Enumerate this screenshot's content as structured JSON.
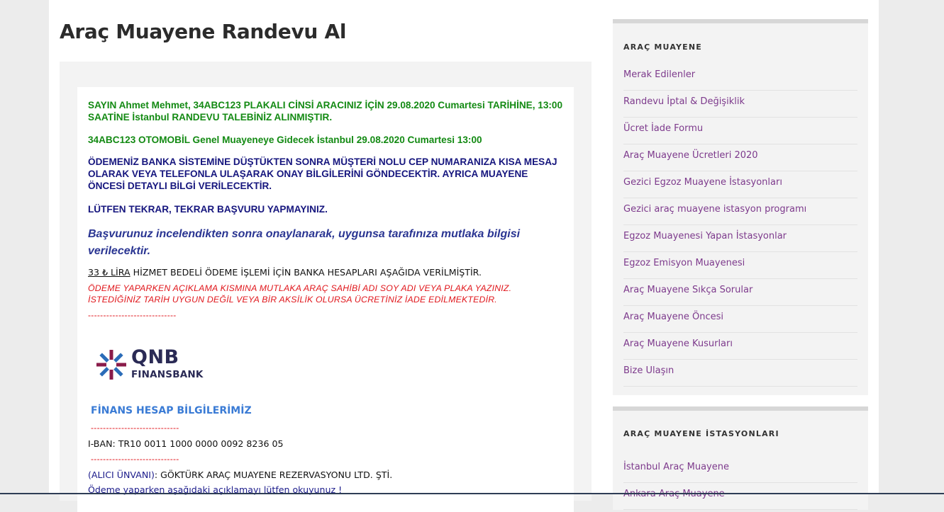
{
  "page_title": "Araç Muayene Randevu Al",
  "notice": {
    "line1": "SAYIN Ahmet Mehmet, 34ABC123 PLAKALI CİNSİ ARACINIZ İÇİN 29.08.2020 Cumartesi TARİHİNE, 13:00 SAATİNE İstanbul RANDEVU TALEBİNİZ ALINMIŞTIR.",
    "line2": "34ABC123 OTOMOBİL Genel Muayeneye Gidecek İstanbul 29.08.2020 Cumartesi 13:00",
    "line3": "ÖDEMENİZ BANKA SİSTEMİNE DÜŞTÜKTEN SONRA MÜŞTERİ NOLU CEP NUMARANIZA KISA MESAJ OLARAK VEYA TELEFONLA ULAŞARAK ONAY BİLGİLERİNİ GÖNDECEKTİR. AYRICA MUAYENE ÖNCESİ DETAYLI BİLGİ VERİLECEKTİR.",
    "line4": "LÜTFEN TEKRAR, TEKRAR BAŞVURU YAPMAYINIZ.",
    "line5": "Başvurunuz incelendikten sonra onaylanarak, uygunsa tarafınıza mutlaka bilgisi verilecektir.",
    "fee_amount": "33 ₺ LİRA",
    "fee_text": " HİZMET BEDELİ ÖDEME İŞLEMİ İÇİN BANKA HESAPLARI AŞAĞIDA VERİLMİŞTİR.",
    "warning": "ÖDEME YAPARKEN AÇIKLAMA KISMINA MUTLAKA ARAÇ SAHİBİ ADI SOY ADI VEYA PLAKA YAZINIZ. İSTEDİĞİNİZ TARİH UYGUN DEĞİL VEYA BİR AKSİLİK OLURSA ÜCRETİNİZ İADE EDİLMEKTEDİR.",
    "dashes": "-----------------------------"
  },
  "bank": {
    "logo_line1": "QNB",
    "logo_line2": "FINANSBANK",
    "title": "FİNANS HESAP BİLGİLERİMİZ",
    "dashes": "-----------------------------",
    "iban": "I-BAN: TR10 0011 1000 0000 0092 8236 05",
    "receiver_label": "(ALICI ÜNVANI)",
    "receiver_name": ": GÖKTÜRK ARAÇ MUAYENE REZERVASYONU LTD. ŞTİ.",
    "note": "Ödeme yaparken aşağıdaki açıklamayı lütfen okuyunuz !"
  },
  "sidebar": {
    "widget1": {
      "title": "ARAÇ MUAYENE",
      "items": [
        {
          "label": "Merak Edilenler"
        },
        {
          "label": "Randevu İptal & Değişiklik"
        },
        {
          "label": "Ücret İade Formu"
        },
        {
          "label": "Araç Muayene Ücretleri 2020"
        },
        {
          "label": "Gezici Egzoz Muayene İstasyonları"
        },
        {
          "label": "Gezici araç muayene istasyon programı"
        },
        {
          "label": "Egzoz Muayenesi Yapan İstasyonlar"
        },
        {
          "label": "Egzoz Emisyon Muayenesi"
        },
        {
          "label": "Araç Muayene Sıkça Sorular"
        },
        {
          "label": "Araç Muayene Öncesi"
        },
        {
          "label": "Araç Muayene Kusurları"
        },
        {
          "label": "Bize Ulaşın"
        }
      ]
    },
    "widget2": {
      "title": "ARAÇ MUAYENE İSTASYONLARI",
      "items": [
        {
          "label": "İstanbul Araç Muayene"
        },
        {
          "label": "Ankara Araç Muayene"
        }
      ]
    }
  },
  "colors": {
    "green_text": "#138a13",
    "navy_text": "#16167e",
    "red_text": "#e0161b",
    "link_purple": "#7d3a8c",
    "bank_title_blue": "#3a7bd5"
  }
}
